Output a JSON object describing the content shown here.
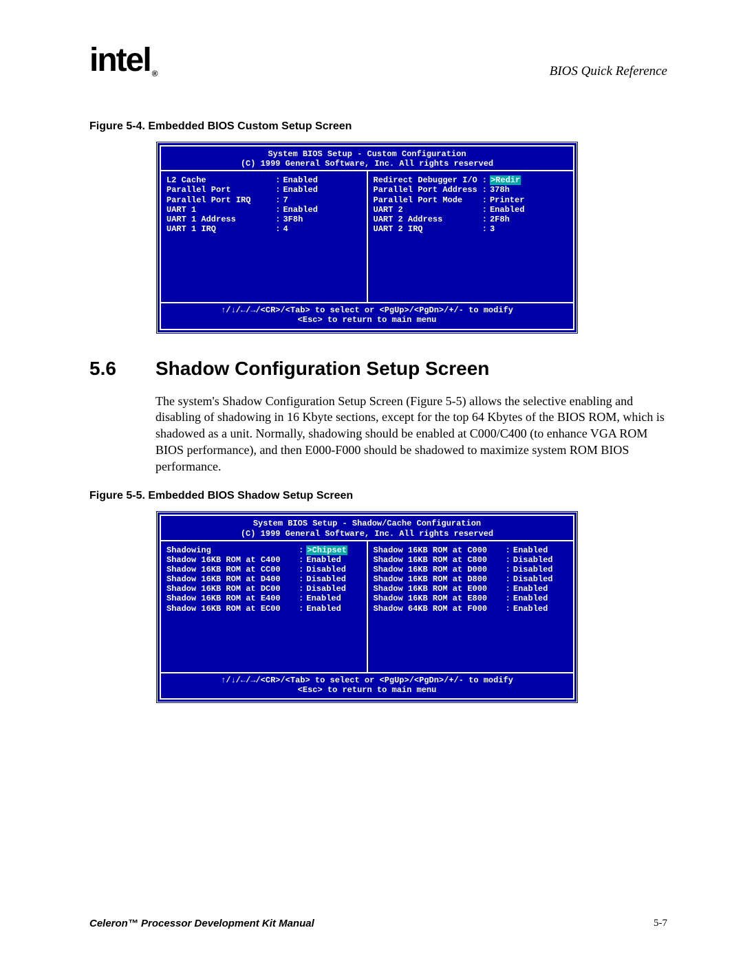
{
  "header": {
    "logo": "intel",
    "logo_sub": "®",
    "right": "BIOS Quick Reference"
  },
  "figure4": {
    "caption": "Figure 5-4. Embedded BIOS Custom Setup Screen",
    "title1": "System BIOS Setup - Custom Configuration",
    "title2": "(C) 1999 General Software, Inc. All rights reserved",
    "left_rows": [
      {
        "label": "L2 Cache",
        "value": "Enabled"
      },
      {
        "label": "Parallel Port",
        "value": "Enabled"
      },
      {
        "label": "Parallel Port IRQ",
        "value": "7"
      },
      {
        "label": "UART 1",
        "value": "Enabled"
      },
      {
        "label": "UART 1 Address",
        "value": "3F8h"
      },
      {
        "label": "UART 1 IRQ",
        "value": "4"
      }
    ],
    "right_rows": [
      {
        "label": "Redirect Debugger I/O",
        "value": ">Redir",
        "highlight": true
      },
      {
        "label": "Parallel Port Address",
        "value": "378h"
      },
      {
        "label": "Parallel Port Mode",
        "value": "Printer"
      },
      {
        "label": "UART 2",
        "value": "Enabled"
      },
      {
        "label": "UART 2 Address",
        "value": "2F8h"
      },
      {
        "label": "UART 2 IRQ",
        "value": "3"
      }
    ],
    "help1": "↑/↓/←/→/<CR>/<Tab> to select  or  <PgUp>/<PgDn>/+/- to modify",
    "help2": "<Esc> to return to main menu"
  },
  "section": {
    "number": "5.6",
    "title": "Shadow Configuration Setup Screen",
    "body": "The system's Shadow Configuration Setup Screen (Figure 5-5) allows the selective enabling and disabling of shadowing in 16 Kbyte sections, except for the top 64 Kbytes of the BIOS ROM, which is shadowed as a unit. Normally, shadowing should be enabled at C000/C400 (to enhance VGA ROM BIOS performance), and then E000-F000 should be shadowed to maximize system ROM BIOS performance."
  },
  "figure5": {
    "caption": "Figure 5-5. Embedded BIOS Shadow Setup Screen",
    "title1": "System BIOS Setup - Shadow/Cache Configuration",
    "title2": "(C) 1999 General Software, Inc. All rights reserved",
    "left_rows": [
      {
        "label": "Shadowing",
        "value": ">Chipset",
        "highlight": true
      },
      {
        "label": "Shadow 16KB ROM at C400",
        "value": "Enabled"
      },
      {
        "label": "Shadow 16KB ROM at CC00",
        "value": "Disabled"
      },
      {
        "label": "Shadow 16KB ROM at D400",
        "value": "Disabled"
      },
      {
        "label": "Shadow 16KB ROM at DC00",
        "value": "Disabled"
      },
      {
        "label": "Shadow 16KB ROM at E400",
        "value": "Enabled"
      },
      {
        "label": "Shadow 16KB ROM at EC00",
        "value": "Enabled"
      }
    ],
    "right_rows": [
      {
        "label": "Shadow 16KB ROM at C000",
        "value": "Enabled"
      },
      {
        "label": "Shadow 16KB ROM at C800",
        "value": "Disabled"
      },
      {
        "label": "Shadow 16KB ROM at D000",
        "value": "Disabled"
      },
      {
        "label": "Shadow 16KB ROM at D800",
        "value": "Disabled"
      },
      {
        "label": "Shadow 16KB ROM at E000",
        "value": "Enabled"
      },
      {
        "label": "Shadow 16KB ROM at E800",
        "value": "Enabled"
      },
      {
        "label": "Shadow 64KB ROM at F000",
        "value": "Enabled"
      }
    ],
    "help1": "↑/↓/←/→/<CR>/<Tab> to select  or  <PgUp>/<PgDn>/+/- to modify",
    "help2": "<Esc> to return to main menu"
  },
  "footer": {
    "left": "Celeron™ Processor Development Kit Manual",
    "right": "5-7"
  }
}
